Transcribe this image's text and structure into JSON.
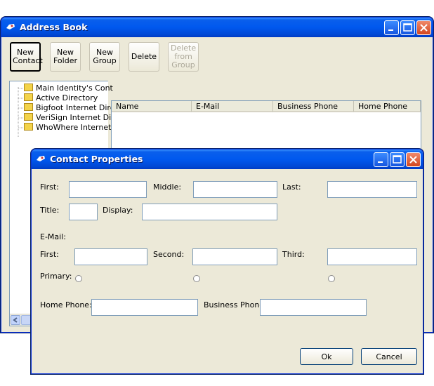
{
  "address_book": {
    "title": "Address Book",
    "toolbar": {
      "new_contact": "New Contact",
      "new_folder": "New Folder",
      "new_group": "New Group",
      "delete": "Delete",
      "delete_from_group": "Delete from Group"
    },
    "tree": [
      {
        "label": "Main Identity's Cont"
      },
      {
        "label": "Active Directory"
      },
      {
        "label": "Bigfoot Internet Dire"
      },
      {
        "label": "VeriSign Internet Dir"
      },
      {
        "label": "WhoWhere Internet"
      }
    ],
    "columns": [
      "Name",
      "E-Mail",
      "Business Phone",
      "Home Phone"
    ]
  },
  "contact_properties": {
    "title": "Contact Properties",
    "labels": {
      "first": "First:",
      "middle": "Middle:",
      "last": "Last:",
      "title": "Title:",
      "display": "Display:",
      "email": "E-Mail:",
      "email_first": "First:",
      "email_second": "Second:",
      "email_third": "Third:",
      "primary": "Primary:",
      "home_phone": "Home Phone:",
      "business_phone": "Business Phone:"
    },
    "values": {
      "first": "",
      "middle": "",
      "last": "",
      "title": "",
      "display": "",
      "email_first": "",
      "email_second": "",
      "email_third": "",
      "home_phone": "",
      "business_phone": ""
    },
    "buttons": {
      "ok": "Ok",
      "cancel": "Cancel"
    }
  },
  "colors": {
    "titlebar": "#0058EE",
    "window_bg": "#ECE9D8",
    "close_button": "#D2461F"
  }
}
